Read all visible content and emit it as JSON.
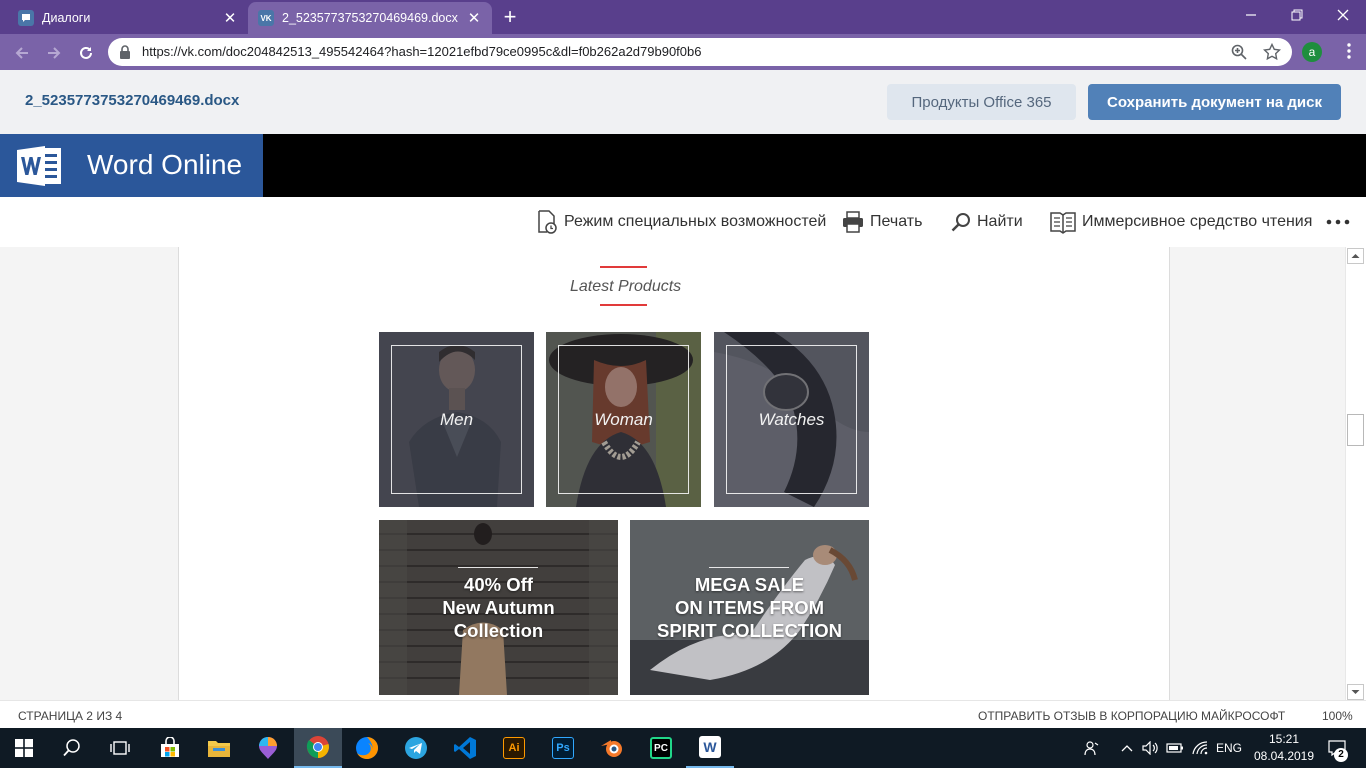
{
  "browser": {
    "tabs": [
      {
        "title": "Диалоги",
        "favicon": "vk-messages-icon",
        "active": false
      },
      {
        "title": "2_5235773753270469469.docx",
        "favicon": "vk-logo-icon",
        "active": true
      }
    ],
    "url": "https://vk.com/doc204842513_495542464?hash=12021efbd79ce0995c&dl=f0b262a2d79b90f0b6",
    "profile_initial": "a"
  },
  "vk_header": {
    "doc_name": "2_5235773753270469469.docx",
    "office_button": "Продукты Office 365",
    "save_button": "Сохранить документ на диск"
  },
  "word": {
    "app_title": "Word Online",
    "toolbar": {
      "accessibility": "Режим специальных возможностей",
      "print": "Печать",
      "find": "Найти",
      "immersive_reader": "Иммерсивное средство чтения"
    }
  },
  "document": {
    "section_title": "Latest Products",
    "categories": [
      {
        "label": "Men"
      },
      {
        "label": "Woman"
      },
      {
        "label": "Watches"
      }
    ],
    "promos": [
      {
        "lines": [
          "40% Off",
          "New Autumn",
          "Collection"
        ]
      },
      {
        "lines": [
          "MEGA SALE",
          "ON ITEMS FROM",
          "SPIRIT COLLECTION"
        ]
      }
    ]
  },
  "status_bar": {
    "page": "СТРАНИЦА 2 ИЗ 4",
    "feedback": "ОТПРАВИТЬ ОТЗЫВ В КОРПОРАЦИЮ МАЙКРОСОФТ",
    "zoom": "100%"
  },
  "taskbar": {
    "apps": [
      "windows-start-icon",
      "search-icon",
      "task-view-icon",
      "store-icon",
      "file-explorer-icon",
      "paint-3d-icon",
      "chrome-icon",
      "firefox-icon",
      "telegram-icon",
      "vscode-icon",
      "illustrator-icon",
      "photoshop-icon",
      "blender-icon",
      "pycharm-icon",
      "word-icon"
    ],
    "illustrator_label": "Ai",
    "photoshop_label": "Ps",
    "pycharm_label": "PC",
    "word_label": "W",
    "language": "ENG",
    "time": "15:21",
    "date": "08.04.2019",
    "notifications": "2"
  },
  "colors": {
    "chrome_frame": "#593f8c",
    "chrome_toolbar": "#7a63a8",
    "vk_link": "#2a5885",
    "vk_button": "#5181b8",
    "word_blue": "#2b579a",
    "accent_red": "#e13a3a",
    "taskbar": "#0f1a24"
  }
}
